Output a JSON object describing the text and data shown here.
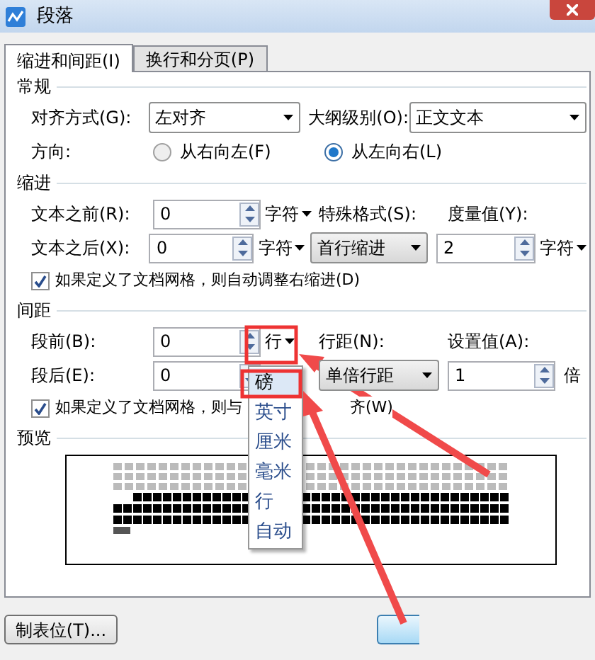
{
  "window": {
    "title": "段落"
  },
  "tabs": [
    {
      "label": "缩进和间距(I)",
      "selected": true
    },
    {
      "label": "换行和分页(P)",
      "selected": false
    }
  ],
  "general": {
    "title": "常规",
    "alignment_label": "对齐方式(G):",
    "alignment_value": "左对齐",
    "outline_label": "大纲级别(O):",
    "outline_value": "正文文本",
    "direction_label": "方向:",
    "directions": [
      {
        "label": "从右向左(F)",
        "selected": false
      },
      {
        "label": "从左向右(L)",
        "selected": true
      }
    ]
  },
  "indent": {
    "title": "缩进",
    "before_label": "文本之前(R):",
    "before_value": "0",
    "before_unit": "字符",
    "special_label": "特殊格式(S):",
    "measure_label": "度量值(Y):",
    "after_label": "文本之后(X):",
    "after_value": "0",
    "after_unit": "字符",
    "special_value": "首行缩进",
    "measure_value": "2",
    "measure_unit": "字符",
    "grid_check": {
      "label": "如果定义了文档网格，则自动调整右缩进(D)",
      "checked": true
    }
  },
  "spacing": {
    "title": "间距",
    "before_label": "段前(B):",
    "before_value": "0",
    "before_unit": "行",
    "line_label": "行距(N):",
    "setting_label": "设置值(A):",
    "after_label": "段后(E):",
    "after_value": "0",
    "line_value": "单倍行距",
    "setting_value": "1",
    "setting_unit": "倍",
    "grid_check": {
      "label": "如果定义了文档网格，则与",
      "label_tail": "齐(W)",
      "checked": true
    }
  },
  "unit_menu": [
    {
      "label": "磅",
      "selected": true
    },
    {
      "label": "英寸",
      "selected": false
    },
    {
      "label": "厘米",
      "selected": false
    },
    {
      "label": "毫米",
      "selected": false
    },
    {
      "label": "行",
      "selected": false
    },
    {
      "label": "自动",
      "selected": false
    }
  ],
  "preview": {
    "title": "预览"
  },
  "buttons": {
    "tabs": "制表位(T)..."
  }
}
